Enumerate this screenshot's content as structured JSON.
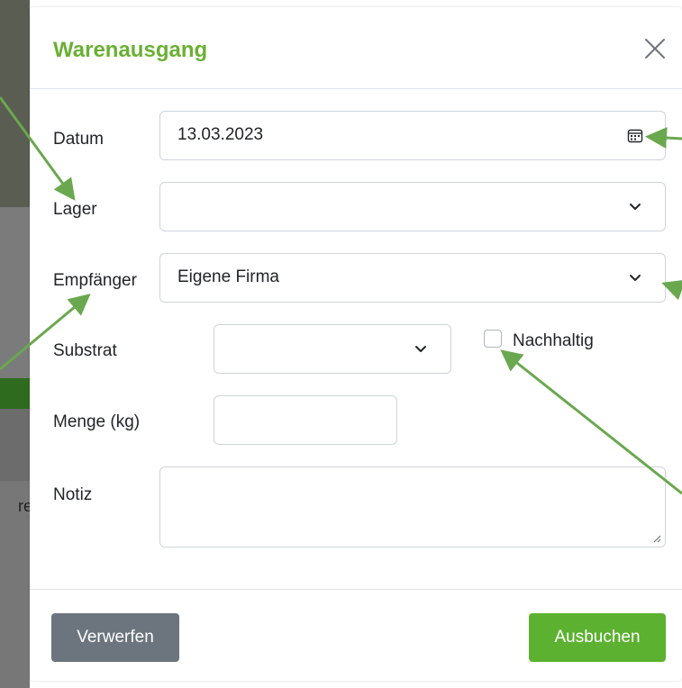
{
  "background": {
    "partial_text": "re"
  },
  "modal": {
    "title": "Warenausgang",
    "colors": {
      "title": "#6ab034",
      "primary_button": "#5cb130",
      "secondary_button": "#6c757d",
      "annotation_arrow": "#6aa84f"
    },
    "fields": {
      "datum": {
        "label": "Datum",
        "value": "13.03.2023",
        "icon": "calendar-icon"
      },
      "lager": {
        "label": "Lager",
        "value": "",
        "icon": "chevron-down-icon"
      },
      "empfaenger": {
        "label": "Empfänger",
        "value": "Eigene Firma",
        "icon": "chevron-down-icon"
      },
      "substrat": {
        "label": "Substrat",
        "value": "",
        "icon": "chevron-down-icon"
      },
      "nachhaltig": {
        "label": "Nachhaltig",
        "checked": false
      },
      "menge": {
        "label": "Menge (kg)",
        "value": ""
      },
      "notiz": {
        "label": "Notiz",
        "value": ""
      }
    },
    "footer": {
      "discard_label": "Verwerfen",
      "submit_label": "Ausbuchen"
    }
  }
}
